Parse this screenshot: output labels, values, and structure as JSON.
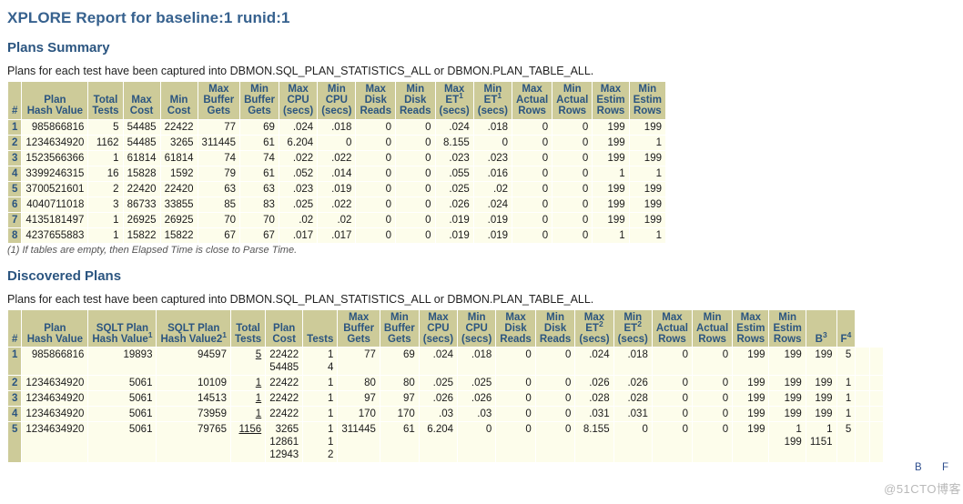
{
  "report": {
    "title": "XPLORE Report for baseline:1 runid:1"
  },
  "plans_summary": {
    "heading": "Plans Summary",
    "caption": "Plans for each test have been captured into DBMON.SQL_PLAN_STATISTICS_ALL or DBMON.PLAN_TABLE_ALL.",
    "footnote": "(1) If tables are empty, then Elapsed Time is close to Parse Time.",
    "columns": [
      {
        "lines": [
          "",
          "",
          "#"
        ]
      },
      {
        "lines": [
          "",
          "Plan",
          "Hash Value"
        ]
      },
      {
        "lines": [
          "",
          "Total",
          "Tests"
        ]
      },
      {
        "lines": [
          "",
          "Max",
          "Cost"
        ]
      },
      {
        "lines": [
          "",
          "Min",
          "Cost"
        ]
      },
      {
        "lines": [
          "Max",
          "Buffer",
          "Gets"
        ]
      },
      {
        "lines": [
          "Min",
          "Buffer",
          "Gets"
        ]
      },
      {
        "lines": [
          "Max",
          "CPU",
          "(secs)"
        ]
      },
      {
        "lines": [
          "Min",
          "CPU",
          "(secs)"
        ]
      },
      {
        "lines": [
          "Max",
          "Disk",
          "Reads"
        ]
      },
      {
        "lines": [
          "Min",
          "Disk",
          "Reads"
        ]
      },
      {
        "lines": [
          "Max",
          "ET",
          "(secs)"
        ],
        "sup": "1",
        "sup_line": 1
      },
      {
        "lines": [
          "Min",
          "ET",
          "(secs)"
        ],
        "sup": "1",
        "sup_line": 1
      },
      {
        "lines": [
          "Max",
          "Actual",
          "Rows"
        ]
      },
      {
        "lines": [
          "Min",
          "Actual",
          "Rows"
        ]
      },
      {
        "lines": [
          "Max",
          "Estim",
          "Rows"
        ]
      },
      {
        "lines": [
          "Min",
          "Estim",
          "Rows"
        ]
      }
    ],
    "rows": [
      [
        "1",
        "985866816",
        "5",
        "54485",
        "22422",
        "77",
        "69",
        ".024",
        ".018",
        "0",
        "0",
        ".024",
        ".018",
        "0",
        "0",
        "199",
        "199"
      ],
      [
        "2",
        "1234634920",
        "1162",
        "54485",
        "3265",
        "311445",
        "61",
        "6.204",
        "0",
        "0",
        "0",
        "8.155",
        "0",
        "0",
        "0",
        "199",
        "1"
      ],
      [
        "3",
        "1523566366",
        "1",
        "61814",
        "61814",
        "74",
        "74",
        ".022",
        ".022",
        "0",
        "0",
        ".023",
        ".023",
        "0",
        "0",
        "199",
        "199"
      ],
      [
        "4",
        "3399246315",
        "16",
        "15828",
        "1592",
        "79",
        "61",
        ".052",
        ".014",
        "0",
        "0",
        ".055",
        ".016",
        "0",
        "0",
        "1",
        "1"
      ],
      [
        "5",
        "3700521601",
        "2",
        "22420",
        "22420",
        "63",
        "63",
        ".023",
        ".019",
        "0",
        "0",
        ".025",
        ".02",
        "0",
        "0",
        "199",
        "199"
      ],
      [
        "6",
        "4040711018",
        "3",
        "86733",
        "33855",
        "85",
        "83",
        ".025",
        ".022",
        "0",
        "0",
        ".026",
        ".024",
        "0",
        "0",
        "199",
        "199"
      ],
      [
        "7",
        "4135181497",
        "1",
        "26925",
        "26925",
        "70",
        "70",
        ".02",
        ".02",
        "0",
        "0",
        ".019",
        ".019",
        "0",
        "0",
        "199",
        "199"
      ],
      [
        "8",
        "4237655883",
        "1",
        "15822",
        "15822",
        "67",
        "67",
        ".017",
        ".017",
        "0",
        "0",
        ".019",
        ".019",
        "0",
        "0",
        "1",
        "1"
      ]
    ]
  },
  "discovered_plans": {
    "heading": "Discovered Plans",
    "caption": "Plans for each test have been captured into DBMON.SQL_PLAN_STATISTICS_ALL or DBMON.PLAN_TABLE_ALL.",
    "columns": [
      {
        "lines": [
          "",
          "",
          "#"
        ]
      },
      {
        "lines": [
          "",
          "Plan",
          "Hash Value"
        ]
      },
      {
        "lines": [
          "",
          "SQLT Plan",
          "Hash Value"
        ],
        "sup": "1",
        "sup_line": 2
      },
      {
        "lines": [
          "",
          "SQLT Plan",
          "Hash Value2"
        ],
        "sup": "1",
        "sup_line": 2
      },
      {
        "lines": [
          "",
          "Total",
          "Tests"
        ]
      },
      {
        "lines": [
          "",
          "Plan",
          "Cost"
        ]
      },
      {
        "lines": [
          "",
          "",
          "Tests"
        ]
      },
      {
        "lines": [
          "Max",
          "Buffer",
          "Gets"
        ]
      },
      {
        "lines": [
          "Min",
          "Buffer",
          "Gets"
        ]
      },
      {
        "lines": [
          "Max",
          "CPU",
          "(secs)"
        ]
      },
      {
        "lines": [
          "Min",
          "CPU",
          "(secs)"
        ]
      },
      {
        "lines": [
          "Max",
          "Disk",
          "Reads"
        ]
      },
      {
        "lines": [
          "Min",
          "Disk",
          "Reads"
        ]
      },
      {
        "lines": [
          "Max",
          "ET",
          "(secs)"
        ],
        "sup": "2",
        "sup_line": 1
      },
      {
        "lines": [
          "Min",
          "ET",
          "(secs)"
        ],
        "sup": "2",
        "sup_line": 1
      },
      {
        "lines": [
          "Max",
          "Actual",
          "Rows"
        ]
      },
      {
        "lines": [
          "Min",
          "Actual",
          "Rows"
        ]
      },
      {
        "lines": [
          "Max",
          "Estim",
          "Rows"
        ]
      },
      {
        "lines": [
          "Min",
          "Estim",
          "Rows"
        ]
      },
      {
        "lines": [
          "",
          "",
          "B"
        ],
        "sup": "3",
        "sup_line": 2
      },
      {
        "lines": [
          "",
          "",
          "F"
        ],
        "sup": "4",
        "sup_line": 2
      }
    ],
    "rows": [
      {
        "idx": "1",
        "cells": [
          "985866816",
          "19893",
          "94597",
          {
            "text": "5",
            "underline": true
          },
          "22422\n54485",
          "1\n4",
          "77",
          "69",
          ".024",
          ".018",
          "0",
          "0",
          ".024",
          ".018",
          "0",
          "0",
          "199",
          "199",
          "199",
          "5"
        ]
      },
      {
        "idx": "2",
        "cells": [
          "1234634920",
          "5061",
          "10109",
          {
            "text": "1",
            "underline": true
          },
          "22422",
          "1",
          "80",
          "80",
          ".025",
          ".025",
          "0",
          "0",
          ".026",
          ".026",
          "0",
          "0",
          "199",
          "199",
          "199",
          "1"
        ]
      },
      {
        "idx": "3",
        "cells": [
          "1234634920",
          "5061",
          "14513",
          {
            "text": "1",
            "underline": true
          },
          "22422",
          "1",
          "97",
          "97",
          ".026",
          ".026",
          "0",
          "0",
          ".028",
          ".028",
          "0",
          "0",
          "199",
          "199",
          "199",
          "1"
        ]
      },
      {
        "idx": "4",
        "cells": [
          "1234634920",
          "5061",
          "73959",
          {
            "text": "1",
            "underline": true
          },
          "22422",
          "1",
          "170",
          "170",
          ".03",
          ".03",
          "0",
          "0",
          ".031",
          ".031",
          "0",
          "0",
          "199",
          "199",
          "199",
          "1"
        ]
      },
      {
        "idx": "5",
        "cells": [
          "1234634920",
          "5061",
          "79765",
          {
            "text": "1156",
            "underline": true
          },
          "3265\n12861\n12943",
          "1\n1\n2",
          "311445",
          "61",
          "6.204",
          "0",
          "0",
          "0",
          "8.155",
          "0",
          "0",
          "0",
          "199",
          "1\n199",
          "1\n1151",
          "5"
        ]
      }
    ]
  },
  "overlay": {
    "b_label": "B",
    "f_label": "F",
    "watermark": "@51CTO博客"
  },
  "colors": {
    "header_bg": "#cdcb99",
    "row_bg": "#fdfdeb",
    "title": "#36618e",
    "heading": "#2b5580"
  }
}
